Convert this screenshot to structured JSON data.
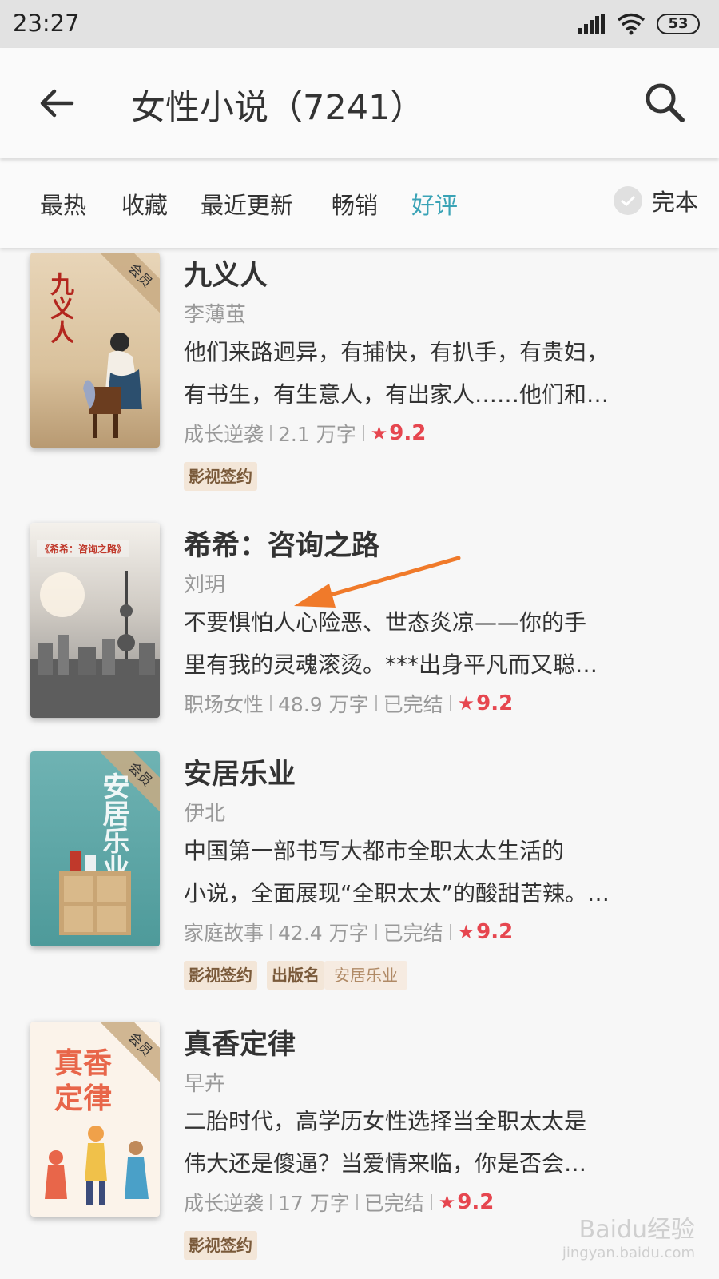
{
  "status_bar": {
    "time": "23:27",
    "battery": "53"
  },
  "header": {
    "title": "女性小说（7241）"
  },
  "filters": {
    "tabs": [
      {
        "label": "最热"
      },
      {
        "label": "收藏"
      },
      {
        "label": "最近更新"
      },
      {
        "label": "畅销"
      },
      {
        "label": "好评"
      }
    ],
    "active_tab": "好评",
    "finished_label": "完本"
  },
  "books": [
    {
      "title": "九义人",
      "author": "李薄茧",
      "desc_line1": "他们来路迥异，有捕快，有扒手，有贵妇，",
      "desc_line2": "有书生，有生意人，有出家人……他们和…",
      "category": "成长逆袭",
      "words": "2.1 万字",
      "rating": "9.2",
      "tags": [
        "影视签约"
      ],
      "cover_text": "九义人",
      "vip": "会员"
    },
    {
      "title": "希希：咨询之路",
      "author": "刘玥",
      "desc_line1": "不要惧怕人心险恶、世态炎凉——你的手",
      "desc_line2": "里有我的灵魂滚烫。***出身平凡而又聪…",
      "category": "职场女性",
      "words": "48.9 万字",
      "status": "已完结",
      "rating": "9.2",
      "cover_text": "《希希：咨询之路》"
    },
    {
      "title": "安居乐业",
      "author": "伊北",
      "desc_line1": "中国第一部书写大都市全职太太生活的",
      "desc_line2": "小说，全面展现“全职太太”的酸甜苦辣。…",
      "category": "家庭故事",
      "words": "42.4 万字",
      "status": "已完结",
      "rating": "9.2",
      "tags": [
        "影视签约",
        "出版名"
      ],
      "tag_extra": "安居乐业",
      "cover_text": "安居乐业",
      "vip": "会员"
    },
    {
      "title": "真香定律",
      "author": "早卉",
      "desc_line1": "二胎时代，高学历女性选择当全职太太是",
      "desc_line2": "伟大还是傻逼？当爱情来临，你是否会…",
      "category": "成长逆袭",
      "words": "17 万字",
      "status": "已完结",
      "rating": "9.2",
      "tags": [
        "影视签约"
      ],
      "cover_text_1": "真香",
      "cover_text_2": "定律",
      "vip": "会员"
    }
  ],
  "watermark": {
    "main": "Baidu经验",
    "sub": "jingyan.baidu.com"
  },
  "colors": {
    "accent": "#3aa3b6",
    "rating": "#e6464f",
    "tag_bg": "#f3e6d8",
    "arrow": "#f07a2a"
  }
}
